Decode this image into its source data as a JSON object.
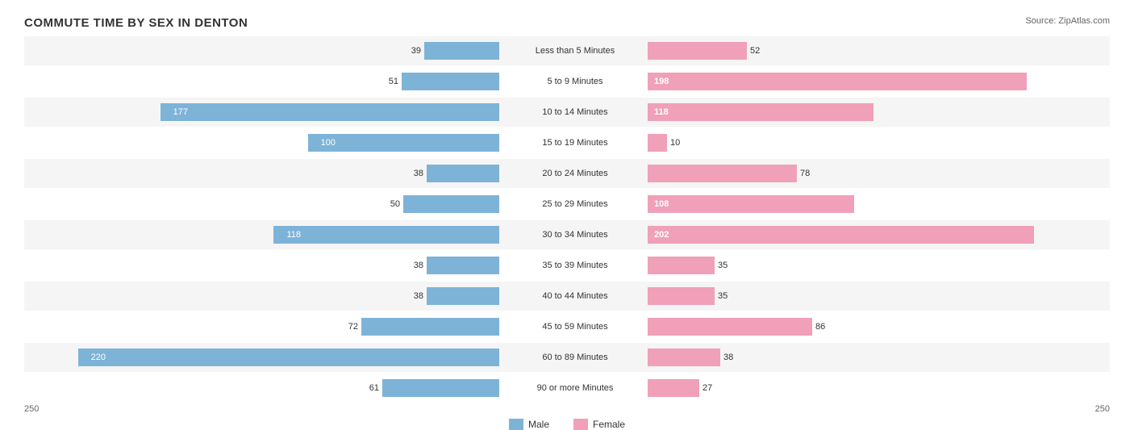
{
  "title": "COMMUTE TIME BY SEX IN DENTON",
  "source": "Source: ZipAtlas.com",
  "colors": {
    "male": "#7eb3d8",
    "female": "#f0a0b8",
    "female_highlight": "#f08098"
  },
  "scale": {
    "left": "250",
    "right": "250"
  },
  "legend": {
    "male": "Male",
    "female": "Female"
  },
  "rows": [
    {
      "label": "Less than 5 Minutes",
      "male": 39,
      "female": 52
    },
    {
      "label": "5 to 9 Minutes",
      "male": 51,
      "female": 198
    },
    {
      "label": "10 to 14 Minutes",
      "male": 177,
      "female": 118
    },
    {
      "label": "15 to 19 Minutes",
      "male": 100,
      "female": 10
    },
    {
      "label": "20 to 24 Minutes",
      "male": 38,
      "female": 78
    },
    {
      "label": "25 to 29 Minutes",
      "male": 50,
      "female": 108
    },
    {
      "label": "30 to 34 Minutes",
      "male": 118,
      "female": 202
    },
    {
      "label": "35 to 39 Minutes",
      "male": 38,
      "female": 35
    },
    {
      "label": "40 to 44 Minutes",
      "male": 38,
      "female": 35
    },
    {
      "label": "45 to 59 Minutes",
      "male": 72,
      "female": 86
    },
    {
      "label": "60 to 89 Minutes",
      "male": 220,
      "female": 38
    },
    {
      "label": "90 or more Minutes",
      "male": 61,
      "female": 27
    }
  ]
}
